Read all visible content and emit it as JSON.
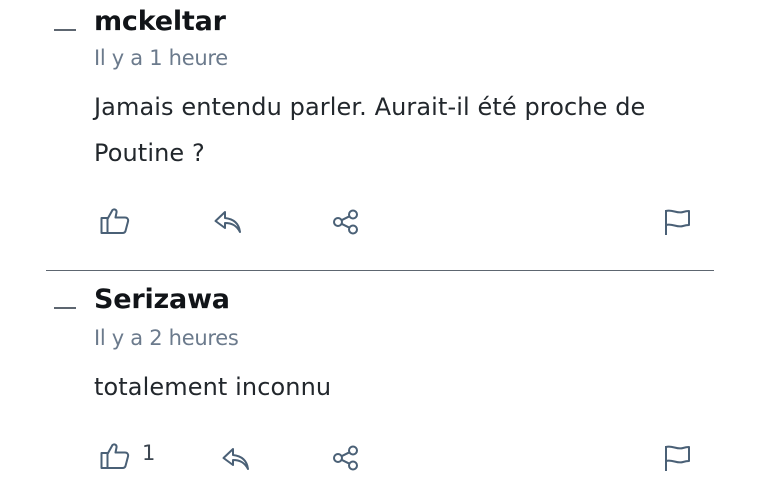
{
  "comments": [
    {
      "author": "mckeltar",
      "time": "Il y a 1 heure",
      "text": "Jamais entendu parler. Aurait-il été proche de Poutine ?",
      "likes": ""
    },
    {
      "author": "Serizawa",
      "time": "Il y a 2 heures",
      "text": "totalement inconnu",
      "likes": "1"
    }
  ],
  "icons": {
    "like": "thumbs-up-icon",
    "reply": "reply-icon",
    "share": "share-icon",
    "report": "flag-icon"
  },
  "colors": {
    "icon": "#4a6076",
    "time": "#6b7a8c",
    "divider": "#5d6670"
  }
}
